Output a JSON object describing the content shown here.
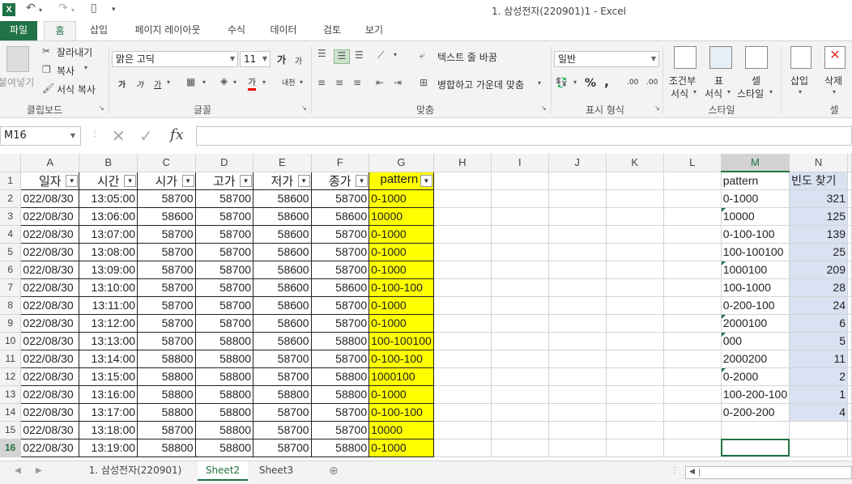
{
  "window": {
    "title": "1. 삼성전자(220901)1 - Excel",
    "app_icon": "X"
  },
  "qat": {
    "undo": "↶",
    "redo": "↷",
    "new": "▯",
    "customize": "▾"
  },
  "tabs": [
    {
      "label": "파일"
    },
    {
      "label": "홈"
    },
    {
      "label": "삽입"
    },
    {
      "label": "페이지 레이아웃"
    },
    {
      "label": "수식"
    },
    {
      "label": "데이터"
    },
    {
      "label": "검토"
    },
    {
      "label": "보기"
    }
  ],
  "ribbon": {
    "clipboard": {
      "paste": "붙여넣기",
      "cut": "잘라내기",
      "copy": "복사",
      "format_painter": "서식 복사",
      "label": "클립보드"
    },
    "font": {
      "name": "맑은 고딕",
      "size": "11",
      "grow": "가",
      "shrink": "가",
      "bold": "가",
      "italic": "가",
      "underline": "가",
      "color_letter": "가",
      "phonetic": "내천",
      "label": "글꼴"
    },
    "alignment": {
      "wrap": "텍스트 줄 바꿈",
      "merge": "병합하고 가운데 맞춤",
      "label": "맞춤"
    },
    "number": {
      "format": "일반",
      "percent": "%",
      "comma": ",",
      "inc": ".00",
      "dec": ".00",
      "label": "표시 형식"
    },
    "styles": {
      "conditional": "조건부",
      "conditional2": "서식",
      "table": "표",
      "table2": "서식",
      "cell": "셀",
      "cell2": "스타일",
      "label": "스타일"
    },
    "cells": {
      "insert": "삽입",
      "delete": "삭제",
      "label": "셀"
    }
  },
  "formula_bar": {
    "name_box": "M16",
    "fx": "fx",
    "value": ""
  },
  "columns": [
    "A",
    "B",
    "C",
    "D",
    "E",
    "F",
    "G",
    "H",
    "I",
    "J",
    "K",
    "L",
    "M",
    "N"
  ],
  "header_row": [
    "일자",
    "시간",
    "시가",
    "고가",
    "저가",
    "종가",
    "pattern"
  ],
  "rows": [
    [
      "022/08/30",
      "13:05:00",
      "58700",
      "58700",
      "58600",
      "58700",
      "0-1000"
    ],
    [
      "022/08/30",
      "13:06:00",
      "58600",
      "58700",
      "58600",
      "58600",
      "10000"
    ],
    [
      "022/08/30",
      "13:07:00",
      "58700",
      "58700",
      "58600",
      "58700",
      "0-1000"
    ],
    [
      "022/08/30",
      "13:08:00",
      "58700",
      "58700",
      "58600",
      "58700",
      "0-1000"
    ],
    [
      "022/08/30",
      "13:09:00",
      "58700",
      "58700",
      "58600",
      "58700",
      "0-1000"
    ],
    [
      "022/08/30",
      "13:10:00",
      "58700",
      "58700",
      "58600",
      "58600",
      "0-100-100"
    ],
    [
      "022/08/30",
      "13:11:00",
      "58700",
      "58700",
      "58600",
      "58700",
      "0-1000"
    ],
    [
      "022/08/30",
      "13:12:00",
      "58700",
      "58700",
      "58600",
      "58700",
      "0-1000"
    ],
    [
      "022/08/30",
      "13:13:00",
      "58700",
      "58800",
      "58600",
      "58800",
      "100-100100"
    ],
    [
      "022/08/30",
      "13:14:00",
      "58800",
      "58800",
      "58700",
      "58700",
      "0-100-100"
    ],
    [
      "022/08/30",
      "13:15:00",
      "58800",
      "58800",
      "58700",
      "58800",
      "1000100"
    ],
    [
      "022/08/30",
      "13:16:00",
      "58800",
      "58800",
      "58800",
      "58800",
      "0-1000"
    ],
    [
      "022/08/30",
      "13:17:00",
      "58800",
      "58800",
      "58700",
      "58700",
      "0-100-100"
    ],
    [
      "022/08/30",
      "13:18:00",
      "58700",
      "58800",
      "58700",
      "58700",
      "10000"
    ],
    [
      "022/08/30",
      "13:19:00",
      "58800",
      "58800",
      "58700",
      "58800",
      "0-1000"
    ]
  ],
  "freq_header": [
    "pattern",
    "빈도 찾기"
  ],
  "freq_rows": [
    [
      "0-1000",
      "321"
    ],
    [
      "10000",
      "125"
    ],
    [
      "0-100-100",
      "139"
    ],
    [
      "100-100100",
      "25"
    ],
    [
      "1000100",
      "209"
    ],
    [
      "100-1000",
      "28"
    ],
    [
      "0-200-100",
      "24"
    ],
    [
      "2000100",
      "6"
    ],
    [
      "000",
      "5"
    ],
    [
      "2000200",
      "11"
    ],
    [
      "0-2000",
      "2"
    ],
    [
      "100-200-100",
      "1"
    ],
    [
      "0-200-200",
      "4"
    ]
  ],
  "sheets": [
    "1. 삼성전자(220901)",
    "Sheet2",
    "Sheet3"
  ],
  "active_sheet": "Sheet2",
  "colors": {
    "excel_green": "#217346",
    "highlight_yellow": "#ffff00",
    "freq_blue": "#d9e1f2"
  }
}
